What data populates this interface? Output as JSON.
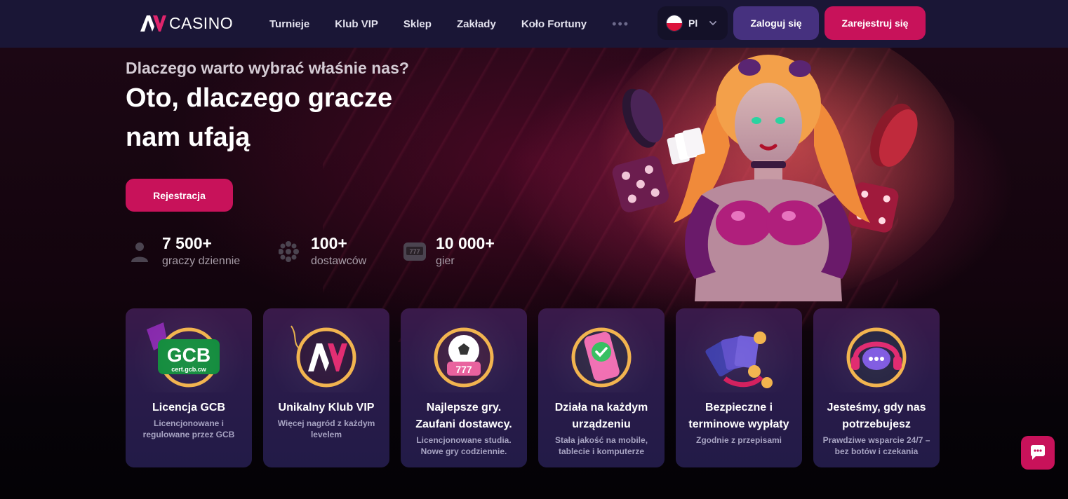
{
  "header": {
    "logo_text": "CASINO",
    "nav": [
      "Turnieje",
      "Klub VIP",
      "Sklep",
      "Zakłady",
      "Koło Fortuny"
    ],
    "more": "•••",
    "language": "Pl",
    "login_label": "Zaloguj się",
    "register_label": "Zarejestruj się"
  },
  "hero": {
    "subtitle": "Dlaczego warto wybrać właśnie nas?",
    "headline": "Oto, dlaczego gracze nam ufają",
    "cta_label": "Rejestracja",
    "stats": [
      {
        "value": "7 500+",
        "label": "graczy dziennie",
        "icon": "user-icon"
      },
      {
        "value": "100+",
        "label": "dostawców",
        "icon": "providers-icon"
      },
      {
        "value": "10 000+",
        "label": "gier",
        "icon": "slot-machine-icon"
      }
    ]
  },
  "cards": [
    {
      "title": "Licencja GCB",
      "desc": "Licencjonowane i regulowane przez GCB",
      "badge_text": "GCB",
      "badge_sub": "cert.gcb.cw"
    },
    {
      "title": "Unikalny Klub VIP",
      "desc": "Więcej nagród z każdym levelem"
    },
    {
      "title": "Najlepsze gry. Zaufani dostawcy.",
      "desc": "Licencjonowane studia. Nowe gry codziennie."
    },
    {
      "title": "Działa na każdym urządzeniu",
      "desc": "Stała jakość na mobile, tablecie i komputerze"
    },
    {
      "title": "Bezpieczne i terminowe wypłaty",
      "desc": "Zgodnie z przepisami"
    },
    {
      "title": "Jesteśmy, gdy nas potrzebujesz",
      "desc": "Prawdziwe wsparcie 24/7 – bez botów i czekania"
    }
  ],
  "colors": {
    "header_bg": "#1a1636",
    "accent_pink": "#c8125a",
    "login_purple": "#46317f"
  }
}
